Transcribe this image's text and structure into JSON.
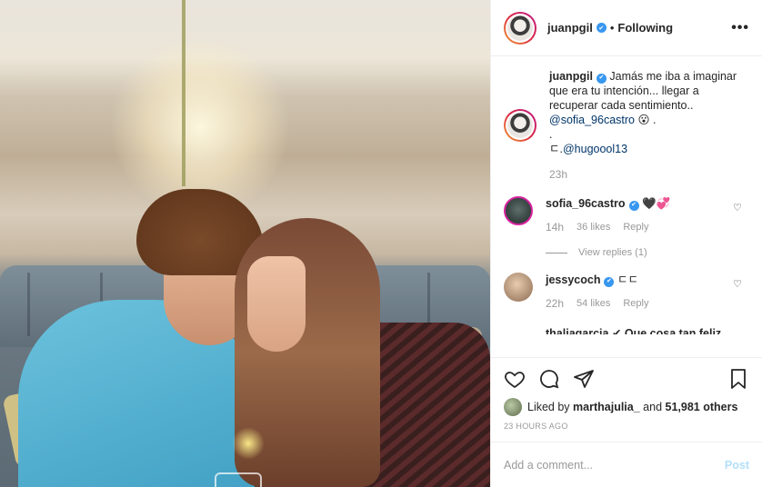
{
  "header": {
    "username": "juanpgil",
    "separator": "•",
    "follow_label": "Following",
    "more_label": "•••"
  },
  "caption": {
    "username": "juanpgil",
    "text": "Jamás me iba a imaginar que era tu intención... llegar a recuperar cada sentimiento..",
    "mention1": "@sofia_96castro",
    "mention1_suffix": "😮 .",
    "dot": ".",
    "line3_prefix": "ㄷ.",
    "mention2": "@hugoool13",
    "time": "23h"
  },
  "comments": [
    {
      "username": "sofia_96castro",
      "text": "🖤💞",
      "time": "14h",
      "likes": "36 likes",
      "reply": "Reply",
      "view_replies": "View replies (1)"
    },
    {
      "username": "jessycoch",
      "text": "ㄷㄷ",
      "time": "22h",
      "likes": "54 likes",
      "reply": "Reply"
    }
  ],
  "cut_comment": "thaliagarcia ✔ Que cosa tan feliz",
  "likes": {
    "prefix": "Liked by",
    "user": "marthajulia_",
    "middle": "and",
    "count": "51,981 others"
  },
  "timestamp": "23 HOURS AGO",
  "add_comment": {
    "placeholder": "Add a comment...",
    "post_label": "Post"
  },
  "icons": [
    "heart-icon",
    "comment-icon",
    "share-icon",
    "bookmark-icon",
    "verified-icon",
    "more-icon"
  ],
  "colors": {
    "verified": "#3897f0",
    "mention": "#003569",
    "muted": "#999999",
    "post_disabled": "#b2dffc"
  }
}
